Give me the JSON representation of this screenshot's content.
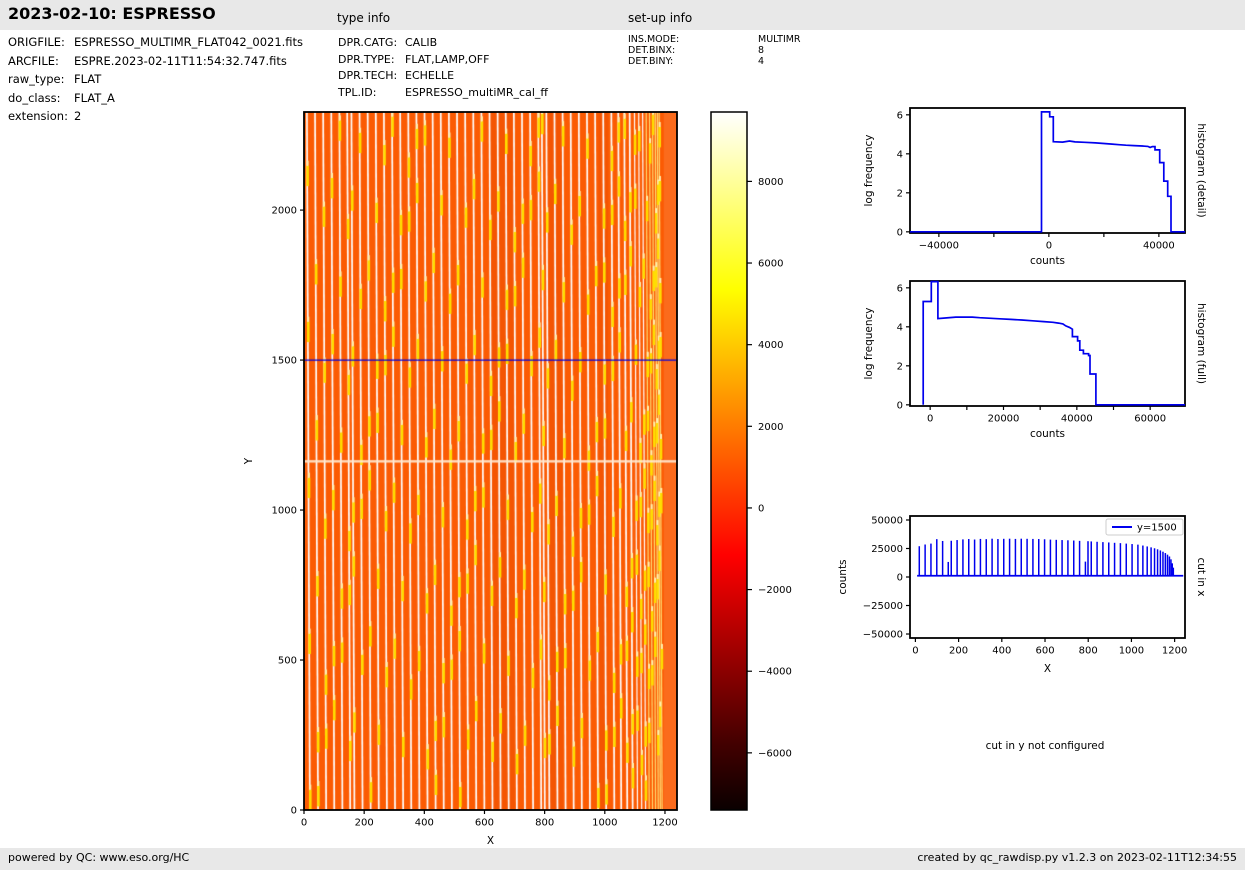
{
  "header": {
    "title": "2023-02-10: ESPRESSO",
    "type_info_label": "type info",
    "setup_info_label": "set-up info"
  },
  "file_info": {
    "rows": [
      {
        "label": "ORIGFILE:",
        "value": "ESPRESSO_MULTIMR_FLAT042_0021.fits"
      },
      {
        "label": "ARCFILE:",
        "value": "ESPRE.2023-02-11T11:54:32.747.fits"
      },
      {
        "label": "raw_type:",
        "value": "FLAT"
      },
      {
        "label": "do_class:",
        "value": "FLAT_A"
      },
      {
        "label": "extension:",
        "value": "2"
      }
    ]
  },
  "type_info": {
    "rows": [
      {
        "label": "DPR.CATG:",
        "value": "CALIB"
      },
      {
        "label": "DPR.TYPE:",
        "value": "FLAT,LAMP,OFF"
      },
      {
        "label": "DPR.TECH:",
        "value": "ECHELLE"
      },
      {
        "label": "TPL.ID:",
        "value": "ESPRESSO_multiMR_cal_ff"
      }
    ]
  },
  "setup_info": {
    "rows": [
      {
        "label": "INS.MODE:",
        "value": "MULTIMR"
      },
      {
        "label": "DET.BINX:",
        "value": "8"
      },
      {
        "label": "DET.BINY:",
        "value": "4"
      }
    ]
  },
  "no_cut_y_text": "cut in y not configured",
  "footer": {
    "left": "powered by QC: www.eso.org/HC",
    "right": "created by qc_rawdisp.py v1.2.3 on 2023-02-11T12:34:55"
  },
  "chart_data": [
    {
      "id": "raw_image",
      "type": "heatmap",
      "xlabel": "X",
      "ylabel": "Y",
      "x_ticks": [
        0,
        200,
        400,
        600,
        800,
        1000,
        1200
      ],
      "y_ticks": [
        0,
        500,
        1000,
        1500,
        2000
      ],
      "x_range": [
        0,
        1240
      ],
      "y_range": [
        0,
        2327
      ],
      "cut_line_y": 1500,
      "bright_row_y": 1163,
      "background_color": "#fb5b03",
      "stripe_color": "#ffffff",
      "trace_color": "#ffdf00",
      "order_stripe_x": [
        18,
        45,
        72,
        99,
        126,
        152,
        166,
        193,
        220,
        247,
        274,
        301,
        328,
        355,
        382,
        409,
        436,
        463,
        490,
        517,
        544,
        571,
        598,
        625,
        652,
        679,
        706,
        733,
        760,
        787,
        799,
        814,
        841,
        868,
        895,
        922,
        949,
        976,
        1003,
        1030,
        1053,
        1073,
        1091,
        1107,
        1121,
        1134,
        1146,
        1157,
        1167,
        1176,
        1183,
        1189
      ],
      "colorbar": {
        "colormap": "hot",
        "vmin": -7400,
        "vmax": 9700,
        "ticks": [
          8000,
          6000,
          4000,
          2000,
          0,
          -2000,
          -4000,
          -6000
        ]
      }
    },
    {
      "id": "histogram_detail",
      "type": "line",
      "xlabel": "counts",
      "ylabel": "log frequency",
      "right_label": "histogram (detail)",
      "x_range": [
        -50500,
        49500
      ],
      "y_range": [
        -0.06,
        6.35
      ],
      "x_ticks": [
        {
          "v": -40000,
          "label": "-40000"
        },
        {
          "v": -20000,
          "label": ""
        },
        {
          "v": 0,
          "label": "0"
        },
        {
          "v": 20000,
          "label": ""
        },
        {
          "v": 40000,
          "label": "40000"
        }
      ],
      "y_ticks": [
        0,
        2,
        4,
        6
      ],
      "line_color": "#0000ee",
      "points": [
        [
          -50500,
          0
        ],
        [
          -2700,
          0
        ],
        [
          -2700,
          6.15
        ],
        [
          300,
          6.15
        ],
        [
          300,
          5.9
        ],
        [
          1600,
          5.9
        ],
        [
          1600,
          4.62
        ],
        [
          5000,
          4.6
        ],
        [
          7500,
          4.66
        ],
        [
          9500,
          4.61
        ],
        [
          13000,
          4.59
        ],
        [
          17000,
          4.56
        ],
        [
          20000,
          4.53
        ],
        [
          23000,
          4.5
        ],
        [
          25500,
          4.47
        ],
        [
          28000,
          4.44
        ],
        [
          31000,
          4.42
        ],
        [
          34000,
          4.4
        ],
        [
          36000,
          4.38
        ],
        [
          36800,
          4.33
        ],
        [
          37600,
          4.37
        ],
        [
          38600,
          4.37
        ],
        [
          38600,
          4.2
        ],
        [
          40300,
          4.2
        ],
        [
          40300,
          3.55
        ],
        [
          41800,
          3.55
        ],
        [
          41800,
          2.6
        ],
        [
          43200,
          2.6
        ],
        [
          43200,
          1.82
        ],
        [
          44400,
          1.82
        ],
        [
          44400,
          0
        ],
        [
          49500,
          0
        ]
      ]
    },
    {
      "id": "histogram_full",
      "type": "line",
      "xlabel": "counts",
      "ylabel": "log frequency",
      "right_label": "histogram (full)",
      "x_range": [
        -5500,
        69500
      ],
      "y_range": [
        -0.06,
        6.35
      ],
      "x_ticks": [
        {
          "v": 0,
          "label": "0"
        },
        {
          "v": 10000,
          "label": ""
        },
        {
          "v": 20000,
          "label": "20000"
        },
        {
          "v": 30000,
          "label": ""
        },
        {
          "v": 40000,
          "label": "40000"
        },
        {
          "v": 50000,
          "label": ""
        },
        {
          "v": 60000,
          "label": "60000"
        }
      ],
      "y_ticks": [
        0,
        2,
        4,
        6
      ],
      "line_color": "#0000ee",
      "points": [
        [
          -1900,
          0
        ],
        [
          -1900,
          5.3
        ],
        [
          300,
          5.3
        ],
        [
          300,
          6.32
        ],
        [
          2100,
          6.32
        ],
        [
          2100,
          4.42
        ],
        [
          4500,
          4.46
        ],
        [
          7000,
          4.5
        ],
        [
          11500,
          4.5
        ],
        [
          13500,
          4.47
        ],
        [
          16000,
          4.44
        ],
        [
          19000,
          4.41
        ],
        [
          22000,
          4.38
        ],
        [
          25000,
          4.35
        ],
        [
          28000,
          4.31
        ],
        [
          31000,
          4.27
        ],
        [
          33500,
          4.23
        ],
        [
          35000,
          4.19
        ],
        [
          36200,
          4.15
        ],
        [
          37000,
          4.05
        ],
        [
          38000,
          3.97
        ],
        [
          38800,
          3.88
        ],
        [
          38800,
          3.5
        ],
        [
          40200,
          3.5
        ],
        [
          40200,
          3.28
        ],
        [
          40800,
          3.28
        ],
        [
          40800,
          2.8
        ],
        [
          41800,
          2.8
        ],
        [
          41800,
          2.62
        ],
        [
          43200,
          2.62
        ],
        [
          43200,
          2.53
        ],
        [
          43600,
          2.53
        ],
        [
          43600,
          1.58
        ],
        [
          45200,
          1.58
        ],
        [
          45200,
          0
        ],
        [
          69500,
          0
        ]
      ]
    },
    {
      "id": "cut_in_x",
      "type": "spikes",
      "xlabel": "X",
      "ylabel": "counts",
      "right_label": "cut in x",
      "legend_label": "y=1500",
      "x_range": [
        -25,
        1248
      ],
      "y_range": [
        -53500,
        53500
      ],
      "x_ticks": [
        0,
        200,
        400,
        600,
        800,
        1000,
        1200
      ],
      "y_ticks": [
        50000,
        25000,
        0,
        -25000,
        -50000
      ],
      "line_color": "#0000ee",
      "baseline": 1100,
      "spikes": [
        [
          18,
          27000
        ],
        [
          45,
          28500
        ],
        [
          72,
          29300
        ],
        [
          99,
          33200
        ],
        [
          126,
          31600
        ],
        [
          152,
          13200
        ],
        [
          166,
          31800
        ],
        [
          193,
          32400
        ],
        [
          220,
          33000
        ],
        [
          247,
          33300
        ],
        [
          274,
          32900
        ],
        [
          301,
          33400
        ],
        [
          328,
          33200
        ],
        [
          355,
          33600
        ],
        [
          382,
          33300
        ],
        [
          409,
          33500
        ],
        [
          436,
          33600
        ],
        [
          463,
          33400
        ],
        [
          490,
          33600
        ],
        [
          517,
          33500
        ],
        [
          544,
          33400
        ],
        [
          571,
          33300
        ],
        [
          598,
          33100
        ],
        [
          625,
          32800
        ],
        [
          652,
          32600
        ],
        [
          679,
          32400
        ],
        [
          706,
          32200
        ],
        [
          733,
          32000
        ],
        [
          760,
          31700
        ],
        [
          787,
          13500
        ],
        [
          799,
          31400
        ],
        [
          814,
          31200
        ],
        [
          841,
          30900
        ],
        [
          868,
          30600
        ],
        [
          895,
          30300
        ],
        [
          922,
          30000
        ],
        [
          949,
          29700
        ],
        [
          976,
          29300
        ],
        [
          1003,
          28900
        ],
        [
          1030,
          28400
        ],
        [
          1053,
          27600
        ],
        [
          1073,
          26800
        ],
        [
          1091,
          26000
        ],
        [
          1107,
          25200
        ],
        [
          1121,
          24300
        ],
        [
          1134,
          23300
        ],
        [
          1146,
          22200
        ],
        [
          1157,
          21000
        ],
        [
          1167,
          19600
        ],
        [
          1176,
          18000
        ],
        [
          1183,
          15500
        ],
        [
          1189,
          12000
        ],
        [
          1194,
          8200
        ]
      ]
    }
  ]
}
